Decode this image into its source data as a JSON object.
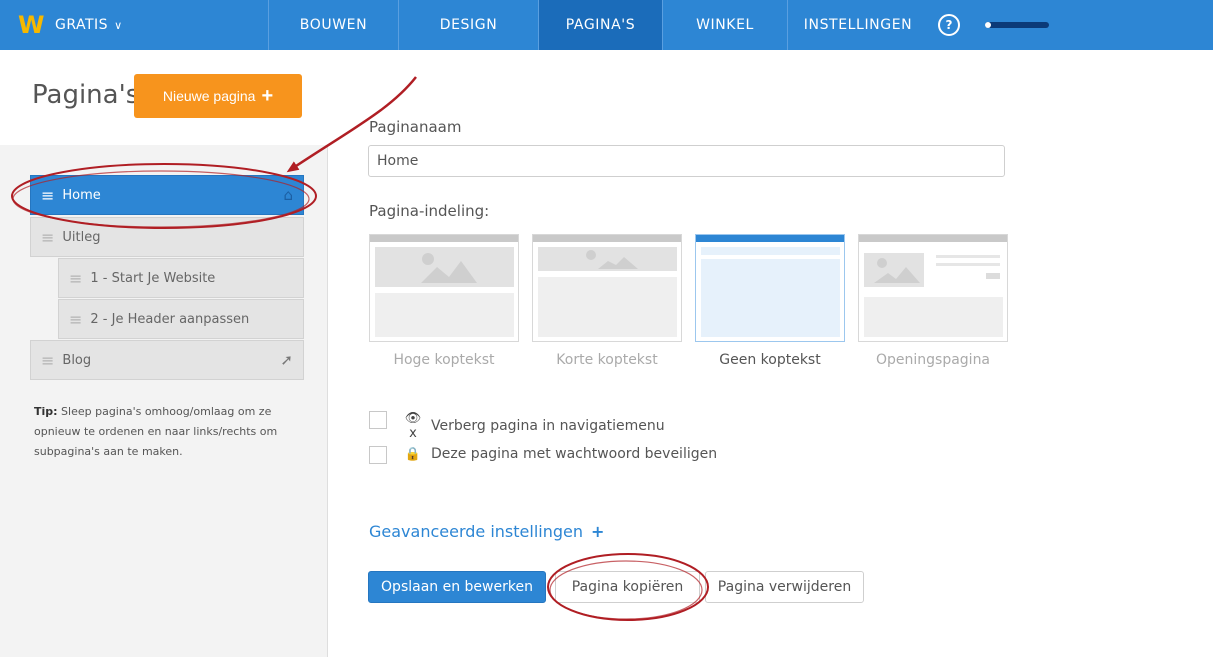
{
  "topbar": {
    "brand": "GRATIS",
    "nav": [
      "BOUWEN",
      "DESIGN",
      "PAGINA'S",
      "WINKEL",
      "INSTELLINGEN"
    ],
    "active_nav": "PAGINA'S",
    "help_symbol": "?",
    "progress_fraction": 0.1
  },
  "sidebar": {
    "title": "Pagina's",
    "new_page_label": "Nieuwe pagina",
    "pages": [
      {
        "label": "Home",
        "icon": "home-icon",
        "active": true
      },
      {
        "label": "Uitleg"
      },
      {
        "label": "1 - Start Je Website"
      },
      {
        "label": "2 - Je Header aanpassen"
      },
      {
        "label": "Blog",
        "icon": "external-link-icon"
      }
    ],
    "tip_label": "Tip:",
    "tip_text": "Sleep pagina's omhoog/omlaag om ze opnieuw te ordenen en naar links/rechts om subpagina's aan te maken."
  },
  "form": {
    "page_name_label": "Paginanaam",
    "page_name_value": "Home",
    "layout_label": "Pagina-indeling:",
    "layouts": [
      "Hoge koptekst",
      "Korte koptekst",
      "Geen koptekst",
      "Openingspagina"
    ],
    "selected_layout": "Geen koptekst",
    "hide_nav_label": "Verberg pagina in navigatiemenu",
    "password_label": "Deze pagina met wachtwoord beveiligen",
    "advanced_label": "Geavanceerde instellingen",
    "advanced_plus": "+",
    "save_edit": "Opslaan en bewerken",
    "copy_page": "Pagina kopiëren",
    "delete_page": "Pagina verwijderen"
  },
  "colors": {
    "topbar": "#2d86d4",
    "accent_orange": "#f7941d",
    "annotation_red": "#b01e24"
  }
}
